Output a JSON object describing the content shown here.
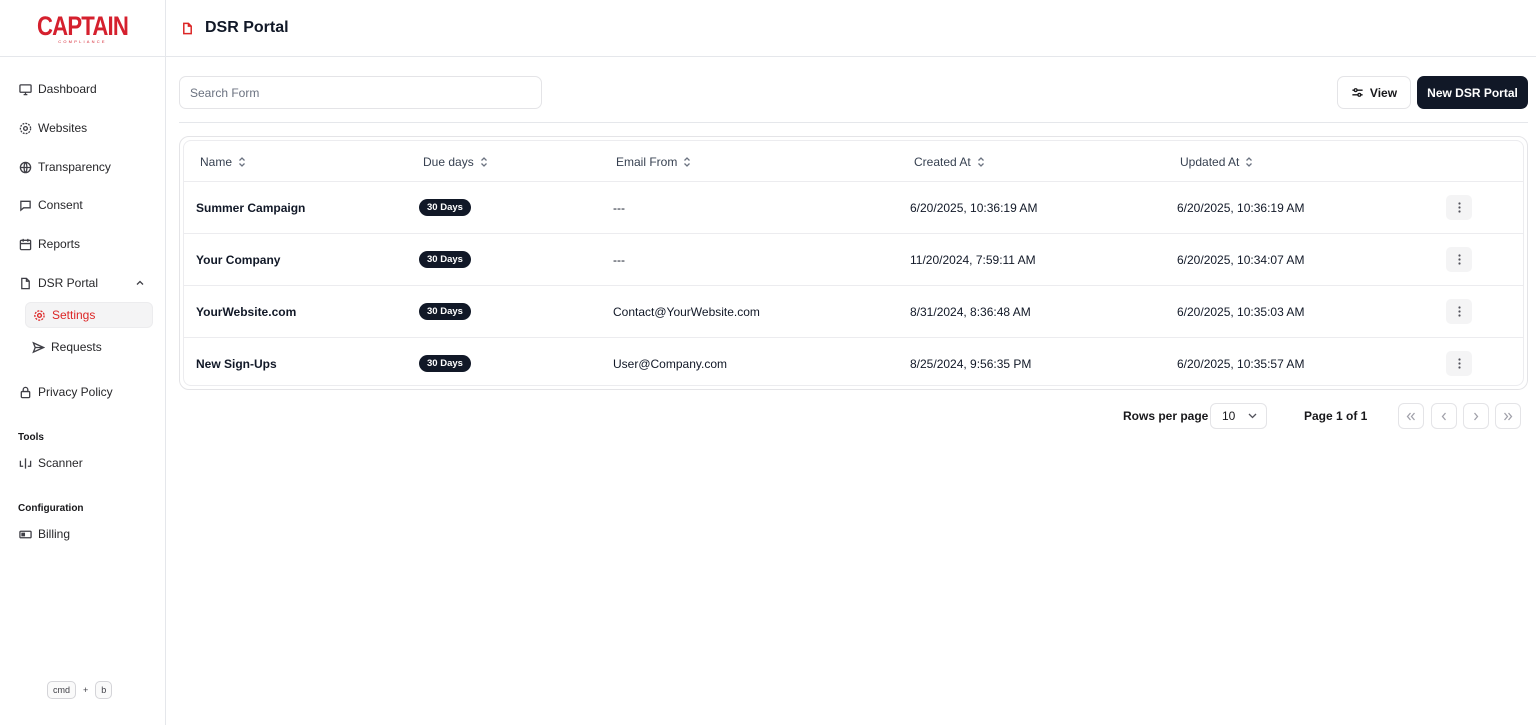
{
  "brand": {
    "name": "CAPTAIN",
    "tagline": "COMPLIANCE"
  },
  "sidebar": {
    "items": [
      {
        "label": "Dashboard",
        "icon": "monitor-icon"
      },
      {
        "label": "Websites",
        "icon": "globe-gear-icon"
      },
      {
        "label": "Transparency",
        "icon": "globe-icon"
      },
      {
        "label": "Consent",
        "icon": "message-square-icon"
      },
      {
        "label": "Reports",
        "icon": "calendar-icon"
      },
      {
        "label": "DSR Portal",
        "icon": "file-icon",
        "expanded": true
      }
    ],
    "dsr_children": [
      {
        "label": "Settings",
        "icon": "gear-icon",
        "active": true
      },
      {
        "label": "Requests",
        "icon": "send-icon"
      }
    ],
    "privacy_policy": {
      "label": "Privacy Policy",
      "icon": "lock-icon"
    },
    "tools": {
      "heading": "Tools",
      "items": [
        {
          "label": "Scanner",
          "icon": "scanner-icon"
        }
      ]
    },
    "configuration": {
      "heading": "Configuration",
      "items": [
        {
          "label": "Billing",
          "icon": "credit-card-icon"
        }
      ]
    },
    "shortcut": {
      "key1": "cmd",
      "plus": "+",
      "key2": "b"
    }
  },
  "header": {
    "title": "DSR Portal",
    "icon": "file-icon"
  },
  "toolbar": {
    "search_placeholder": "Search Form",
    "view_label": "View",
    "new_label": "New DSR Portal"
  },
  "table": {
    "columns": [
      "Name",
      "Due days",
      "Email From",
      "Created At",
      "Updated At"
    ],
    "rows": [
      {
        "name": "Summer Campaign",
        "due": "30 Days",
        "email": "---",
        "created": "6/20/2025, 10:36:19 AM",
        "updated": "6/20/2025, 10:36:19 AM"
      },
      {
        "name": "Your Company",
        "due": "30 Days",
        "email": "---",
        "created": "11/20/2024, 7:59:11 AM",
        "updated": "6/20/2025, 10:34:07 AM"
      },
      {
        "name": "YourWebsite.com",
        "due": "30 Days",
        "email": "Contact@YourWebsite.com",
        "created": "8/31/2024, 8:36:48 AM",
        "updated": "6/20/2025, 10:35:03 AM"
      },
      {
        "name": "New Sign-Ups",
        "due": "30 Days",
        "email": "User@Company.com",
        "created": "8/25/2024, 9:56:35 PM",
        "updated": "6/20/2025, 10:35:57 AM"
      }
    ]
  },
  "pagination": {
    "rows_per_page_label": "Rows per page",
    "rows_per_page_value": "10",
    "page_info": "Page 1 of 1"
  },
  "colors": {
    "brand_red": "#d5202e",
    "primary_dark": "#111827",
    "active_red": "#dc2626"
  }
}
